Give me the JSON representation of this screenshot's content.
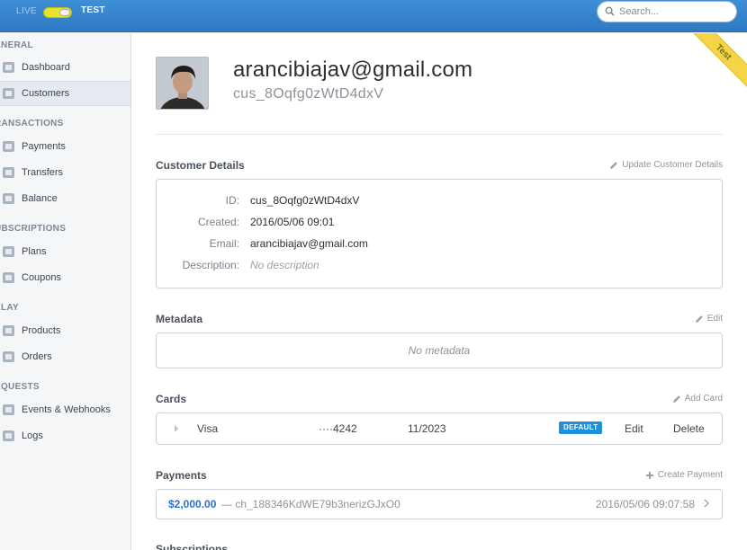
{
  "topbar": {
    "live_label": "LIVE",
    "test_label": "TEST",
    "search_placeholder": "Search..."
  },
  "sidebar": {
    "sections": [
      {
        "title": "ENERAL"
      },
      {
        "title": "RANSACTIONS"
      },
      {
        "title": "UBSCRIPTIONS"
      },
      {
        "title": "ELAY"
      },
      {
        "title": "EQUESTS"
      }
    ],
    "items": [
      {
        "label": "Dashboard",
        "icon": "dashboard-icon"
      },
      {
        "label": "Customers",
        "icon": "customers-icon",
        "active": true
      },
      {
        "label": "Payments",
        "icon": "payments-icon"
      },
      {
        "label": "Transfers",
        "icon": "transfers-icon"
      },
      {
        "label": "Balance",
        "icon": "balance-icon"
      },
      {
        "label": "Plans",
        "icon": "plans-icon"
      },
      {
        "label": "Coupons",
        "icon": "coupons-icon"
      },
      {
        "label": "Products",
        "icon": "products-icon"
      },
      {
        "label": "Orders",
        "icon": "orders-icon"
      },
      {
        "label": "Events & Webhooks",
        "icon": "events-icon"
      },
      {
        "label": "Logs",
        "icon": "logs-icon"
      }
    ]
  },
  "ribbon": {
    "label": "Test"
  },
  "customer": {
    "email": "arancibiajav@gmail.com",
    "id": "cus_8Oqfg0zWtD4dxV"
  },
  "details": {
    "title": "Customer Details",
    "action": "Update Customer Details",
    "rows": [
      {
        "key": "ID:",
        "value": "cus_8Oqfg0zWtD4dxV"
      },
      {
        "key": "Created:",
        "value": "2016/05/06 09:01"
      },
      {
        "key": "Email:",
        "value": "arancibiajav@gmail.com"
      },
      {
        "key": "Description:",
        "value": "No description"
      }
    ]
  },
  "metadata": {
    "title": "Metadata",
    "action": "Edit",
    "empty": "No metadata"
  },
  "cards": {
    "title": "Cards",
    "action": "Add Card",
    "items": [
      {
        "brand": "Visa",
        "last4": "····4242",
        "expiry": "11/2023",
        "badge": "DEFAULT",
        "edit": "Edit",
        "delete": "Delete"
      }
    ]
  },
  "payments": {
    "title": "Payments",
    "action": "Create Payment",
    "items": [
      {
        "amount": "$2,000.00",
        "charge": "— ch_188346KdWE79b3nerizGJxO0",
        "date": "2016/05/06 09:07:58"
      }
    ]
  },
  "subscriptions": {
    "title": "Subscriptions"
  },
  "colors": {
    "topbar": "#2f79c2",
    "toggle": "#e4e52a",
    "default_badge": "#1f8fd9",
    "amount": "#2b70c4",
    "ribbon": "#f4d548"
  }
}
